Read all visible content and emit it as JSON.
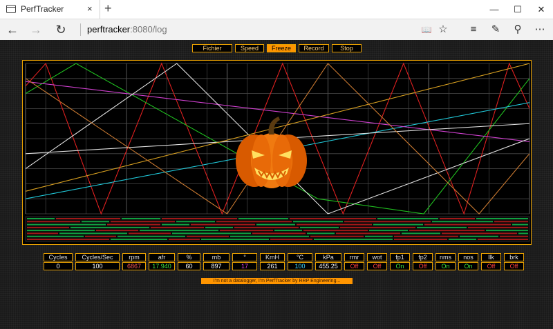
{
  "browser": {
    "tab_title": "PerfTracker",
    "url_host": "perftracker",
    "url_rest": ":8080/log"
  },
  "icons": {
    "tab_close": "×",
    "new_tab": "+",
    "minimize": "—",
    "maximize": "☐",
    "close": "✕",
    "back": "←",
    "forward": "→",
    "refresh": "↻",
    "reading": "📖",
    "favorite": "☆",
    "hub": "≡",
    "note": "✎",
    "share": "⚲",
    "more": "⋯"
  },
  "menu": [
    {
      "label": "Fichier",
      "active": false
    },
    {
      "label": "Speed",
      "active": false
    },
    {
      "label": "Freeze",
      "active": true
    },
    {
      "label": "Record",
      "active": false
    },
    {
      "label": "Stop",
      "active": false
    }
  ],
  "metrics": [
    {
      "label": "Cycles",
      "value": "0",
      "color": "#ffffff"
    },
    {
      "label": "Cycles/Sec",
      "value": "100",
      "color": "#ffffff"
    },
    {
      "label": "rpm",
      "value": "6867",
      "color": "#ff5a5a"
    },
    {
      "label": "afr",
      "value": "17.940",
      "color": "#3ce03c"
    },
    {
      "label": "%",
      "value": "60",
      "color": "#ffffff"
    },
    {
      "label": "mb",
      "value": "897",
      "color": "#ffffff"
    },
    {
      "label": "°",
      "value": "17",
      "color": "#e040e0"
    },
    {
      "label": "KmH",
      "value": "261",
      "color": "#ffffff"
    },
    {
      "label": "°C",
      "value": "100",
      "color": "#40d8ff"
    },
    {
      "label": "kPa",
      "value": "455.25",
      "color": "#ffffff"
    },
    {
      "label": "rmr",
      "value": "Off",
      "color": "#ff4040"
    },
    {
      "label": "wot",
      "value": "Off",
      "color": "#ff4040"
    },
    {
      "label": "fp1",
      "value": "On",
      "color": "#3ce03c"
    },
    {
      "label": "fp2",
      "value": "Off",
      "color": "#ff4040"
    },
    {
      "label": "nms",
      "value": "On",
      "color": "#3ce03c"
    },
    {
      "label": "nos",
      "value": "On",
      "color": "#3ce03c"
    },
    {
      "label": "llk",
      "value": "Off",
      "color": "#ff4040"
    },
    {
      "label": "brk",
      "value": "Off",
      "color": "#ff4040"
    }
  ],
  "footer_note": "I'm not a datalogger, I'm PerfTracker by RRP Engineering...",
  "colors": {
    "accent": "#e8a000",
    "grid": "#8a8a8a",
    "rpm": "#e02020",
    "afr": "#20c020",
    "temp": "#20c8d8",
    "angle": "#d040d0",
    "tps": "#e0e0e0",
    "mb": "#d8a020",
    "kmh": "#c87830",
    "digital_on": "#10a040",
    "digital_off": "#a01818"
  },
  "chart_data": {
    "type": "line",
    "x": [
      0,
      100
    ],
    "ylim": [
      0,
      100
    ],
    "grid": true,
    "series": [
      {
        "key": "rpm",
        "points": [
          [
            0,
            85
          ],
          [
            4,
            100
          ],
          [
            15,
            0
          ],
          [
            27,
            100
          ],
          [
            39,
            0
          ],
          [
            51,
            100
          ],
          [
            63,
            0
          ],
          [
            75,
            100
          ],
          [
            87,
            0
          ],
          [
            96,
            100
          ],
          [
            100,
            70
          ]
        ]
      },
      {
        "key": "afr",
        "points": [
          [
            0,
            80
          ],
          [
            10,
            100
          ],
          [
            58,
            10
          ],
          [
            79,
            0
          ],
          [
            100,
            90
          ]
        ]
      },
      {
        "key": "temp",
        "points": [
          [
            0,
            10
          ],
          [
            100,
            74
          ]
        ]
      },
      {
        "key": "angle",
        "points": [
          [
            0,
            88
          ],
          [
            100,
            48
          ]
        ]
      },
      {
        "key": "tps",
        "points": [
          [
            0,
            40
          ],
          [
            100,
            60
          ]
        ]
      },
      {
        "key": "tps",
        "points": [
          [
            0,
            30
          ],
          [
            30,
            100
          ],
          [
            60,
            0
          ],
          [
            100,
            50
          ]
        ]
      },
      {
        "key": "mb",
        "points": [
          [
            0,
            15
          ],
          [
            100,
            100
          ]
        ]
      },
      {
        "key": "kmh",
        "points": [
          [
            0,
            90
          ],
          [
            40,
            0
          ],
          [
            60,
            100
          ],
          [
            90,
            0
          ],
          [
            100,
            40
          ]
        ]
      }
    ],
    "digital_rows": 8
  }
}
